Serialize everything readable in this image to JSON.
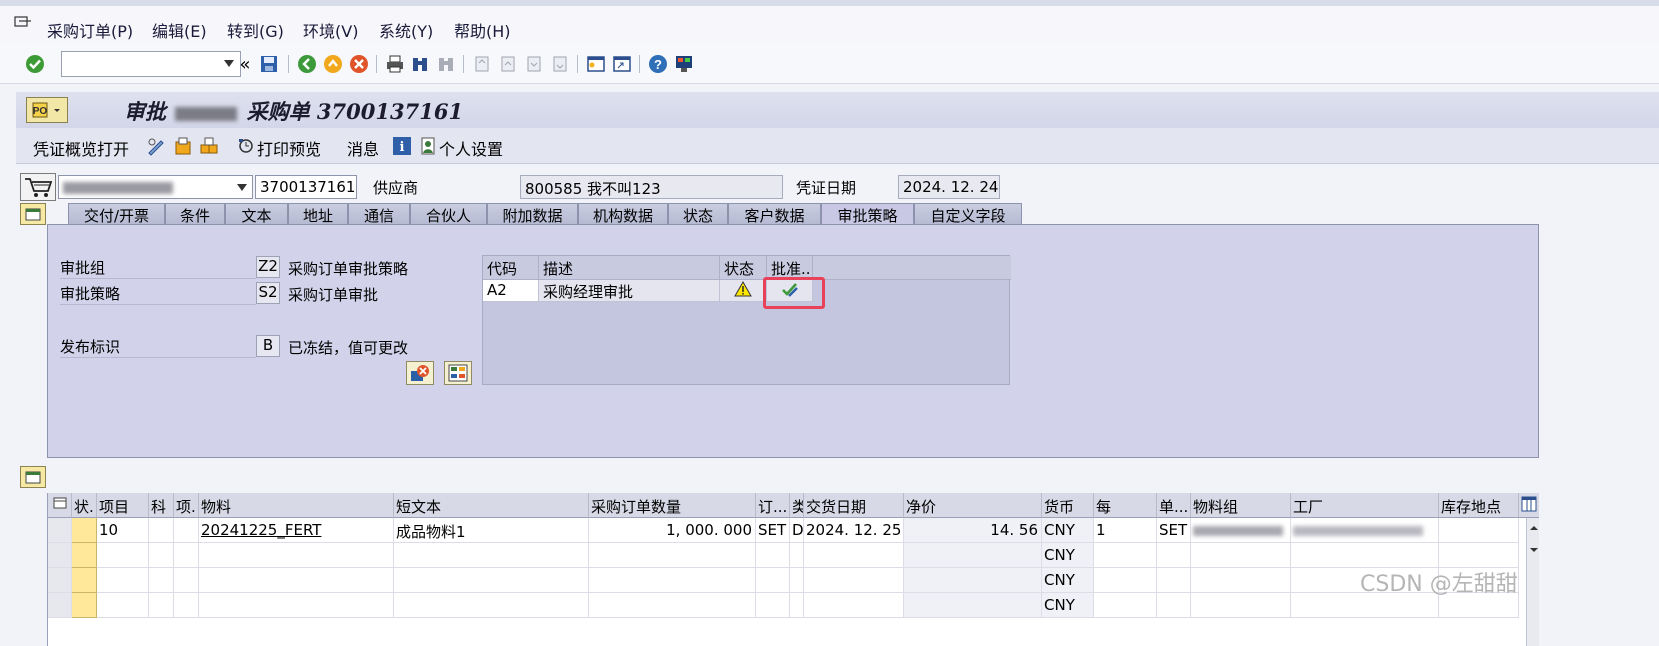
{
  "menu": {
    "items": [
      "采购订单(P)",
      "编辑(E)",
      "转到(G)",
      "环境(V)",
      "系统(Y)",
      "帮助(H)"
    ]
  },
  "toolbar": {
    "command_value": "",
    "icons": [
      "enter-icon",
      "save-icon",
      "back-icon",
      "exit-icon",
      "cancel-icon",
      "print-icon",
      "find-icon",
      "find-next-icon",
      "first-page-icon",
      "prev-page-icon",
      "next-page-icon",
      "last-page-icon",
      "new-session-icon",
      "shortcut-icon",
      "help-icon",
      "customize-layout-icon"
    ]
  },
  "title": {
    "prefix": "审批",
    "suffix": "采购单 3700137161"
  },
  "app_toolbar": {
    "document_overview": "凭证概览打开",
    "print_preview": "打印预览",
    "messages": "消息",
    "personal_settings": "个人设置"
  },
  "header": {
    "order_number": "3700137161",
    "vendor_label": "供应商",
    "vendor_value": "800585 我不叫123",
    "doc_date_label": "凭证日期",
    "doc_date_value": "2024. 12. 24"
  },
  "tabs": [
    "交付/开票",
    "条件",
    "文本",
    "地址",
    "通信",
    "合伙人",
    "附加数据",
    "机构数据",
    "状态",
    "客户数据",
    "审批策略",
    "自定义字段"
  ],
  "active_tab": "审批策略",
  "approval": {
    "group_label": "审批组",
    "group_code": "Z2",
    "group_desc": "采购订单审批策略",
    "strategy_label": "审批策略",
    "strategy_code": "S2",
    "strategy_desc": "采购订单审批",
    "release_label": "发布标识",
    "release_code": "B",
    "release_desc": "已冻结，值可更改",
    "table": {
      "headers": [
        "代码",
        "描述",
        "状态",
        "批准..."
      ],
      "rows": [
        {
          "code": "A2",
          "desc": "采购经理审批",
          "status": "warning",
          "approve": "approve-icon"
        }
      ]
    }
  },
  "items": {
    "headers": [
      "状.",
      "项目",
      "科",
      "项.",
      "物料",
      "短文本",
      "采购订单数量",
      "订...",
      "类",
      "交货日期",
      "净价",
      "货币",
      "每",
      "单...",
      "物料组",
      "工厂",
      "库存地点"
    ],
    "rows": [
      {
        "item": "10",
        "material": "20241225_FERT",
        "short_text": "成品物料1",
        "qty": "1, 000. 000",
        "unit": "SET",
        "cat": "D",
        "delivery": "2024. 12. 25",
        "price": "14. 56",
        "currency": "CNY",
        "per": "1",
        "order_unit": "SET"
      },
      {
        "currency": "CNY"
      },
      {
        "currency": "CNY"
      },
      {
        "currency": "CNY"
      }
    ]
  },
  "watermark": "CSDN @左甜甜"
}
